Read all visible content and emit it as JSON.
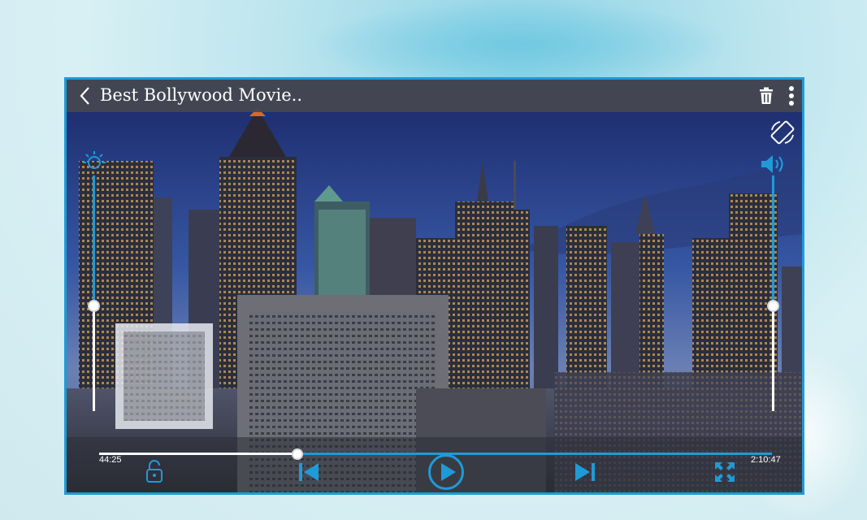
{
  "player": {
    "title": "Best Bollywood Movie..",
    "current_time": "44:25",
    "total_time": "2:10:47",
    "progress": 0.295,
    "brightness": 0.45,
    "volume": 0.45
  },
  "icons": {
    "back": "chevron-left-icon",
    "delete": "trash-icon",
    "menu": "more-vertical-icon",
    "rotate": "screen-rotation-icon",
    "brightness": "brightness-icon",
    "volume": "volume-icon",
    "lock": "lock-open-icon",
    "previous": "skip-previous-icon",
    "play": "play-circle-icon",
    "next": "skip-next-icon",
    "fullscreen": "fullscreen-icon"
  },
  "colors": {
    "accent": "#1e9bd7",
    "topbar": "#46484f",
    "text": "#ffffff"
  }
}
